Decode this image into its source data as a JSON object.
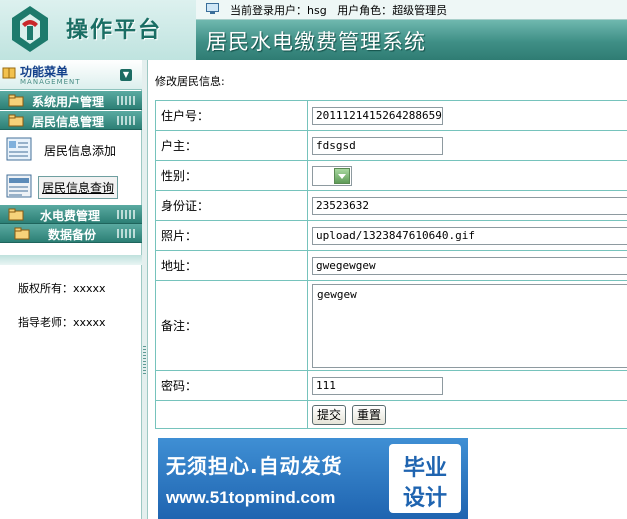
{
  "header": {
    "logo_text": "操作平台",
    "system_title": "居民水电缴费管理系统",
    "user_label": "当前登录用户：",
    "username": "hsg",
    "role_label": "用户角色：",
    "role": "超级管理员"
  },
  "sidebar": {
    "menu_title": "功能菜单",
    "menu_subtitle": "MANAGEMENT",
    "categories": [
      {
        "label": "系统用户管理"
      },
      {
        "label": "居民信息管理"
      },
      {
        "label": "水电费管理"
      },
      {
        "label": "数据备份"
      }
    ],
    "sub_items": [
      {
        "label": "居民信息添加"
      },
      {
        "label": "居民信息查询"
      }
    ],
    "copyright": "版权所有：xxxxx",
    "teacher": "指导老师：xxxxx"
  },
  "main": {
    "caption": "修改居民信息:",
    "fields": {
      "household": {
        "label": "住户号：",
        "value": "2011121415264288659"
      },
      "owner": {
        "label": "户主：",
        "value": "fdsgsd"
      },
      "gender": {
        "label": "性别：",
        "value": ""
      },
      "idcard": {
        "label": "身份证：",
        "value": "23523632"
      },
      "photo": {
        "label": "照片：",
        "value": "upload/1323847610640.gif"
      },
      "address": {
        "label": "地址：",
        "value": "gwegewgew"
      },
      "remark": {
        "label": "备注：",
        "value": "gewgew"
      },
      "password": {
        "label": "密码：",
        "value": "111"
      }
    },
    "submit_label": "提交",
    "reset_label": "重置"
  },
  "ad": {
    "line1": "无须担心.自动发货",
    "line2": "www.51topmind.com",
    "badge_top": "毕业",
    "badge_bottom": "设计"
  },
  "colors": {
    "accent_teal": "#2c7f75",
    "border_teal": "#76c3bc",
    "ad_blue": "#1f64b0"
  },
  "icons": {
    "logo": "bank-logo-icon",
    "user": "monitor-icon",
    "menu": "book-icon",
    "collapse": "chevron-down-icon",
    "category": "folder-icon",
    "add": "form-add-icon",
    "query": "form-query-icon"
  }
}
